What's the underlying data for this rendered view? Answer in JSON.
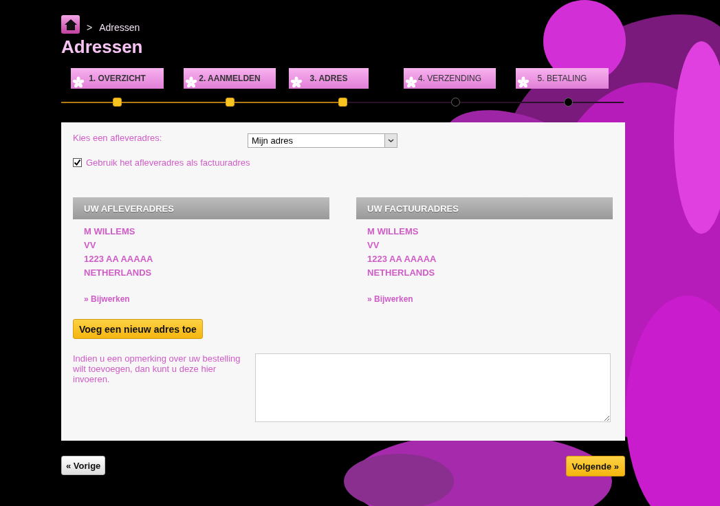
{
  "breadcrumb": {
    "separator": ">",
    "current": "Adressen"
  },
  "title": "Adressen",
  "steps": [
    {
      "label": "1. OVERZICHT",
      "done": true
    },
    {
      "label": "2. AANMELDEN",
      "done": true
    },
    {
      "label": "3. ADRES",
      "done": true
    },
    {
      "label": "4. VERZENDING",
      "done": false
    },
    {
      "label": "5. BETALING",
      "done": false
    }
  ],
  "delivery_select": {
    "label": "Kies een afleveradres:",
    "value": "Mijn adres"
  },
  "same_address": {
    "label": "Gebruik het afleveradres als factuuradres",
    "checked": true
  },
  "addresses": [
    {
      "heading": "UW AFLEVERADRES",
      "lines": [
        "M WILLEMS",
        "VV",
        "1223 AA AAAAA",
        "NETHERLANDS"
      ],
      "link": "» Bijwerken"
    },
    {
      "heading": "UW FACTUURADRES",
      "lines": [
        "M WILLEMS",
        "VV",
        "1223 AA AAAAA",
        "NETHERLANDS"
      ],
      "link": "» Bijwerken"
    }
  ],
  "add_button": "Voeg een nieuw adres toe",
  "remark": {
    "label": "Indien u een opmerking over uw bestelling wilt toevoegen, dan kunt u deze hier invoeren."
  },
  "prev_button": "« Vorige",
  "next_button": "Volgende »"
}
